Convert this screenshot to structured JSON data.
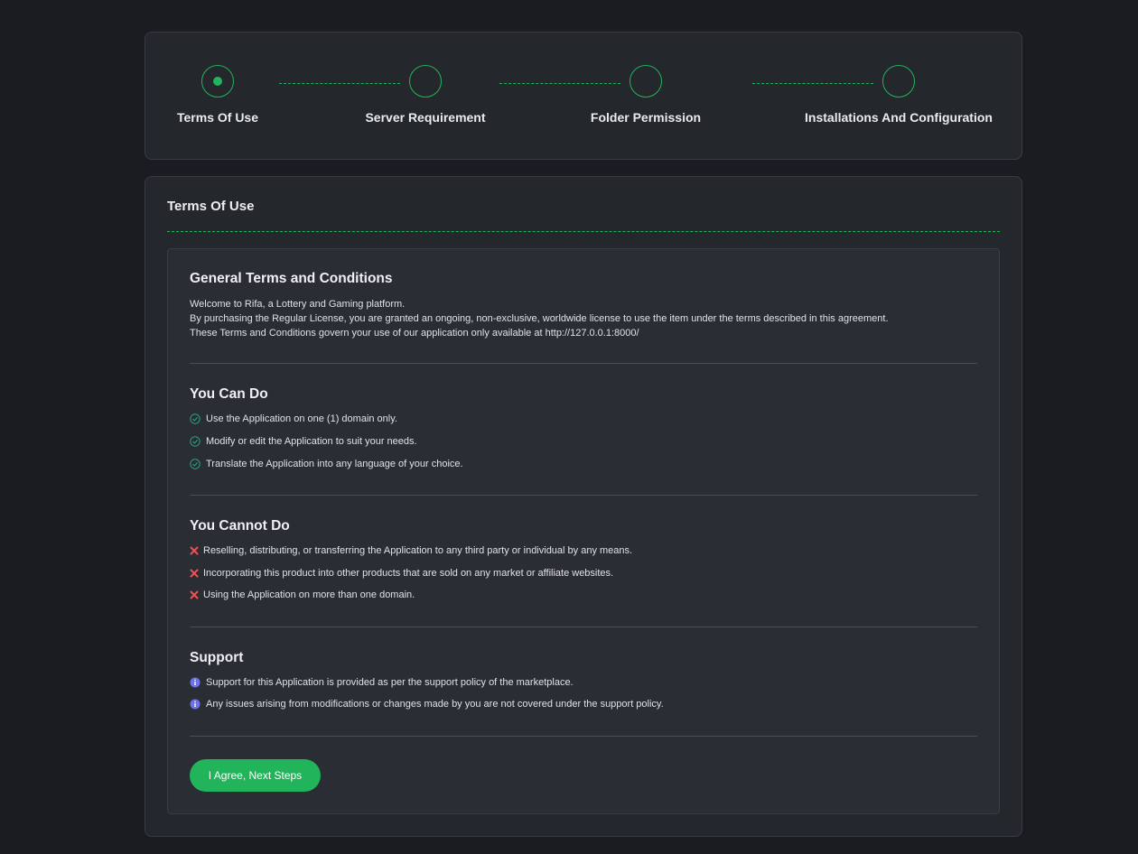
{
  "steps": [
    {
      "label": "Terms Of Use",
      "active": true
    },
    {
      "label": "Server Requirement",
      "active": false
    },
    {
      "label": "Folder Permission",
      "active": false
    },
    {
      "label": "Installations And Configuration",
      "active": false
    }
  ],
  "main": {
    "title": "Terms Of Use",
    "general": {
      "title": "General Terms and Conditions",
      "lines": [
        "Welcome to Rifa, a Lottery and Gaming platform.",
        "By purchasing the Regular License, you are granted an ongoing, non-exclusive, worldwide license to use the item under the terms described in this agreement.",
        "These Terms and Conditions govern your use of our application only available at http://127.0.0.1:8000/"
      ]
    },
    "can_do": {
      "title": "You Can Do",
      "items": [
        "Use the Application on one (1) domain only.",
        "Modify or edit the Application to suit your needs.",
        "Translate the Application into any language of your choice."
      ]
    },
    "cannot_do": {
      "title": "You Cannot Do",
      "items": [
        "Reselling, distributing, or transferring the Application to any third party or individual by any means.",
        "Incorporating this product into other products that are sold on any market or affiliate websites.",
        "Using the Application on more than one domain."
      ]
    },
    "support": {
      "title": "Support",
      "items": [
        "Support for this Application is provided as per the support policy of the marketplace.",
        "Any issues arising from modifications or changes made by you are not covered under the support policy."
      ]
    },
    "agree_button": "I Agree, Next Steps"
  },
  "icons": {
    "check": "check-circle-icon",
    "cross": "x-icon",
    "info": "info-circle-icon"
  },
  "colors": {
    "accent": "#22b45a",
    "check": "#2ba37e",
    "cross": "#f05252",
    "info": "#6b74e8",
    "background": "#1b1c21",
    "card": "#24272c"
  }
}
